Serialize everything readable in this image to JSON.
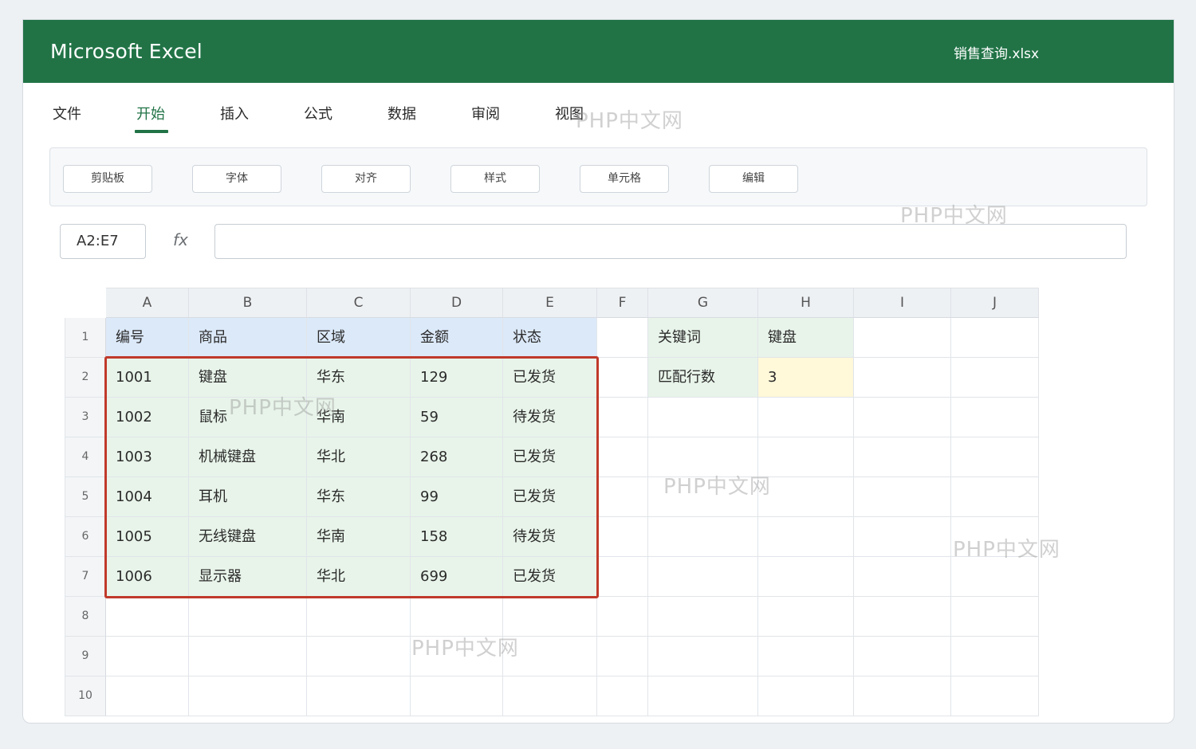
{
  "app": {
    "title": "Microsoft Excel",
    "file": "销售查询.xlsx"
  },
  "tabs": [
    "文件",
    "开始",
    "插入",
    "公式",
    "数据",
    "审阅",
    "视图"
  ],
  "active_tab": "开始",
  "groups": [
    "剪贴板",
    "字体",
    "对齐",
    "样式",
    "单元格",
    "编辑"
  ],
  "formula_bar": {
    "name_box": "A2:E7",
    "fx": "fx",
    "formula": ""
  },
  "columns": [
    "A",
    "B",
    "C",
    "D",
    "E",
    "F",
    "G",
    "H",
    "I",
    "J"
  ],
  "rows": [
    "1",
    "2",
    "3",
    "4",
    "5",
    "6",
    "7",
    "8",
    "9",
    "10"
  ],
  "table": {
    "header": [
      "编号",
      "商品",
      "区域",
      "金额",
      "状态"
    ],
    "data": [
      [
        "1001",
        "键盘",
        "华东",
        "129",
        "已发货"
      ],
      [
        "1002",
        "鼠标",
        "华南",
        "59",
        "待发货"
      ],
      [
        "1003",
        "机械键盘",
        "华北",
        "268",
        "已发货"
      ],
      [
        "1004",
        "耳机",
        "华东",
        "99",
        "已发货"
      ],
      [
        "1005",
        "无线键盘",
        "华南",
        "158",
        "待发货"
      ],
      [
        "1006",
        "显示器",
        "华北",
        "699",
        "已发货"
      ]
    ]
  },
  "lookup": {
    "keyword_label": "关键词",
    "keyword_value": "键盘",
    "count_label": "匹配行数",
    "count_value": "3"
  },
  "watermark_text": "PHP中文网",
  "colors": {
    "brand": "#217346",
    "selection": "#c0392b",
    "header_fill": "#dce9f9",
    "data_fill": "#e8f4ea",
    "result_fill": "#fff8d9"
  }
}
